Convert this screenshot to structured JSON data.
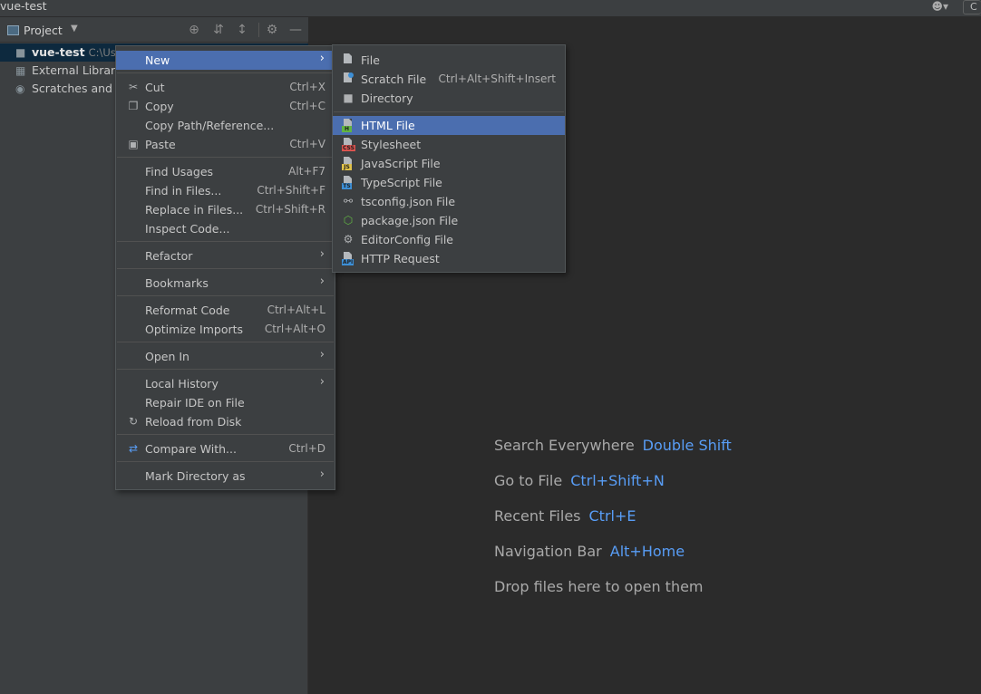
{
  "window": {
    "title": "vue-test",
    "user_icon": "user-icon",
    "config_label": "C"
  },
  "project_panel": {
    "title": "Project",
    "tree": [
      {
        "name": "vue-test",
        "path": "C:\\Use",
        "icon": "folder-icon"
      },
      {
        "name": "External Libraries",
        "icon": "libraries-icon"
      },
      {
        "name": "Scratches and Co",
        "icon": "scratches-icon"
      }
    ]
  },
  "context_menu": {
    "items": [
      {
        "label": "New",
        "shortcut": "",
        "submenu": true
      },
      {
        "label": "Cut",
        "shortcut": "Ctrl+X"
      },
      {
        "label": "Copy",
        "shortcut": "Ctrl+C"
      },
      {
        "label": "Copy Path/Reference...",
        "shortcut": ""
      },
      {
        "label": "Paste",
        "shortcut": "Ctrl+V"
      },
      {
        "label": "Find Usages",
        "shortcut": "Alt+F7"
      },
      {
        "label": "Find in Files...",
        "shortcut": "Ctrl+Shift+F"
      },
      {
        "label": "Replace in Files...",
        "shortcut": "Ctrl+Shift+R"
      },
      {
        "label": "Inspect Code...",
        "shortcut": ""
      },
      {
        "label": "Refactor",
        "shortcut": "",
        "submenu": true
      },
      {
        "label": "Bookmarks",
        "shortcut": "",
        "submenu": true
      },
      {
        "label": "Reformat Code",
        "shortcut": "Ctrl+Alt+L"
      },
      {
        "label": "Optimize Imports",
        "shortcut": "Ctrl+Alt+O"
      },
      {
        "label": "Open In",
        "shortcut": "",
        "submenu": true
      },
      {
        "label": "Local History",
        "shortcut": "",
        "submenu": true
      },
      {
        "label": "Repair IDE on File",
        "shortcut": ""
      },
      {
        "label": "Reload from Disk",
        "shortcut": ""
      },
      {
        "label": "Compare With...",
        "shortcut": "Ctrl+D"
      },
      {
        "label": "Mark Directory as",
        "shortcut": "",
        "submenu": true
      }
    ]
  },
  "new_submenu": {
    "items": [
      {
        "label": "File",
        "shortcut": ""
      },
      {
        "label": "Scratch File",
        "shortcut": "Ctrl+Alt+Shift+Insert"
      },
      {
        "label": "Directory",
        "shortcut": ""
      },
      {
        "label": "HTML File",
        "shortcut": "",
        "tag": "H",
        "tag_color": "#62b543"
      },
      {
        "label": "Stylesheet",
        "shortcut": "",
        "tag": "CSS",
        "tag_color": "#d9534f"
      },
      {
        "label": "JavaScript File",
        "shortcut": "",
        "tag": "JS",
        "tag_color": "#e0c24a"
      },
      {
        "label": "TypeScript File",
        "shortcut": "",
        "tag": "TS",
        "tag_color": "#3d8fd6"
      },
      {
        "label": "tsconfig.json File",
        "shortcut": ""
      },
      {
        "label": "package.json File",
        "shortcut": ""
      },
      {
        "label": "EditorConfig File",
        "shortcut": ""
      },
      {
        "label": "HTTP Request",
        "shortcut": "",
        "tag": "API",
        "tag_color": "#3d8fd6"
      }
    ]
  },
  "editor_hints": [
    {
      "text": "Search Everywhere",
      "key": "Double Shift"
    },
    {
      "text": "Go to File",
      "key": "Ctrl+Shift+N"
    },
    {
      "text": "Recent Files",
      "key": "Ctrl+E"
    },
    {
      "text": "Navigation Bar",
      "key": "Alt+Home"
    },
    {
      "text": "Drop files here to open them",
      "key": ""
    }
  ],
  "colors": {
    "accent": "#4b6eaf",
    "link": "#589df6",
    "background": "#2b2b2b",
    "panel": "#3c3f41"
  }
}
